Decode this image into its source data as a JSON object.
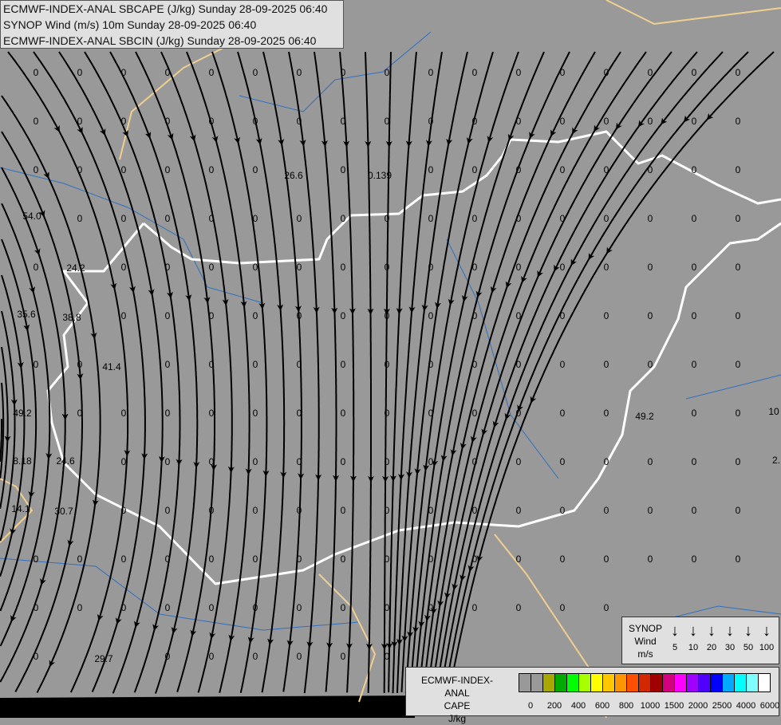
{
  "header": {
    "lines": [
      "ECMWF-INDEX-ANAL SBCAPE (J/kg) Sunday 28-09-2025 06:40",
      "SYNOP Wind (m/s) 10m Sunday 28-09-2025 06:40",
      "ECMWF-INDEX-ANAL SBCIN (J/kg) Sunday 28-09-2025 06:40"
    ]
  },
  "map": {
    "background_color": "#999999",
    "national_border_color": "#ffffff",
    "other_border_color": "#f0d090",
    "river_color": "#3070c0",
    "streamline_color": "#000000",
    "cin_zero_value": "0",
    "cin_labels": [
      "54.0",
      "24.2",
      "35.6",
      "38.8",
      "41.4",
      "49.2",
      "8.18",
      "24.6",
      "14.1",
      "30.7",
      "29.7",
      "26.6",
      "0.139",
      "49.2",
      "10",
      "2."
    ]
  },
  "synop_legend": {
    "label_lines": [
      "SYNOP",
      "Wind",
      "m/s"
    ],
    "arrow_icon": "down-arrow",
    "speeds": [
      "5",
      "10",
      "20",
      "30",
      "50",
      "100"
    ]
  },
  "cape_legend": {
    "label_lines": [
      "ECMWF-INDEX-ANAL",
      "CAPE",
      "J/kg"
    ],
    "colors": [
      "#999999",
      "#999999",
      "#a8a800",
      "#00a800",
      "#00ff00",
      "#a8ff00",
      "#ffff00",
      "#ffc800",
      "#ff9600",
      "#ff5000",
      "#d22800",
      "#a00000",
      "#d2007f",
      "#ff00ff",
      "#a000ff",
      "#5000ff",
      "#0000ff",
      "#00aaff",
      "#00ffff",
      "#80ffff",
      "#ffffff"
    ],
    "ticks": [
      "0",
      "200",
      "400",
      "600",
      "800",
      "1000",
      "1500",
      "2000",
      "2500",
      "4000",
      "6000"
    ]
  }
}
